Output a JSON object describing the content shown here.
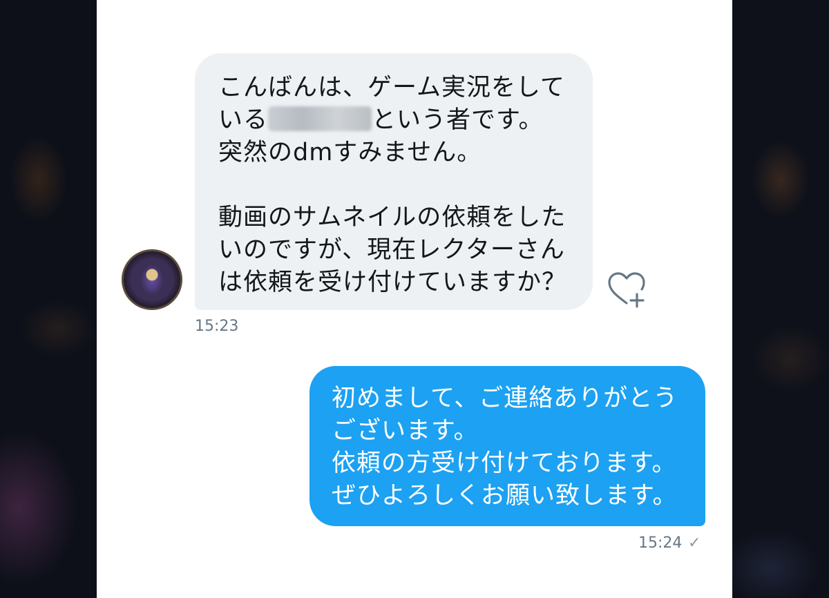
{
  "conversation": {
    "incoming": {
      "text_before_name": "こんばんは、ゲーム実況をして\nいる",
      "sender_name_redacted": true,
      "text_after_name": "という者です。\n突然のdmすみません。\n\n動画のサムネイルの依頼をした\nいのですが、現在レクターさん\nは依頼を受け付けていますか？",
      "time": "15:23"
    },
    "outgoing": {
      "text": "初めまして、ご連絡ありがとう\nございます。\n依頼の方受け付けております。\nぜひよろしくお願い致します。",
      "time": "15:24",
      "status_icon": "✓"
    }
  },
  "icons": {
    "like": "heart-plus-icon",
    "avatar": "user-avatar",
    "read_status": "checkmark-icon"
  },
  "colors": {
    "incoming_bubble": "#eef1f3",
    "outgoing_bubble": "#1da1f2",
    "timestamp": "#657786",
    "panel_bg": "#ffffff"
  }
}
